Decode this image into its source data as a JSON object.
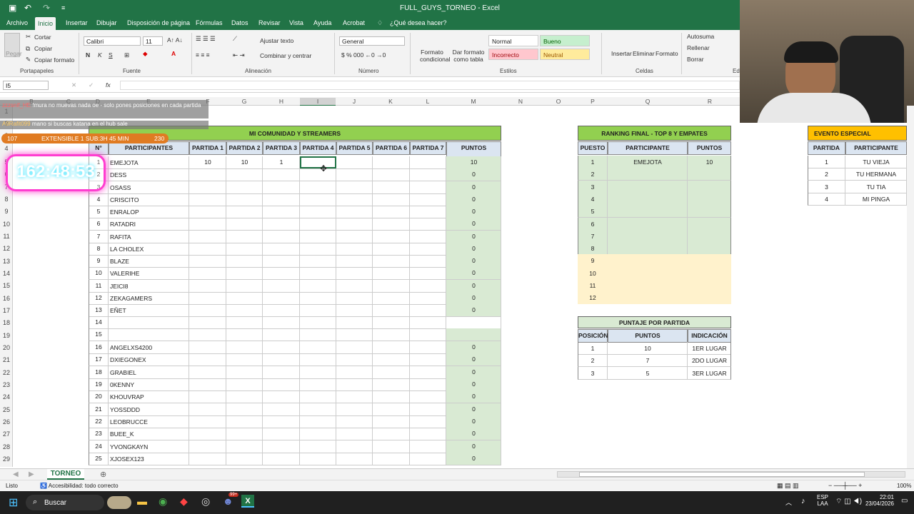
{
  "title": {
    "file": "FULL_GUYS_TORNEO",
    "app": "Excel",
    "sep": " - "
  },
  "tabs": [
    "Archivo",
    "Inicio",
    "Insertar",
    "Dibujar",
    "Disposición de página",
    "Fórmulas",
    "Datos",
    "Revisar",
    "Vista",
    "Ayuda",
    "Acrobat"
  ],
  "tell": "¿Qué desea hacer?",
  "ribbon": {
    "clipboard": {
      "paste": "Pegar",
      "cut": "Cortar",
      "copy": "Copiar",
      "format": "Copiar formato",
      "label": "Portapapeles"
    },
    "font": {
      "name": "Calibri",
      "size": "11",
      "label": "Fuente",
      "b": "N",
      "i": "K",
      "u": "S"
    },
    "align": {
      "wrap": "Ajustar texto",
      "merge": "Combinar y centrar",
      "label": "Alineación"
    },
    "number": {
      "format": "General",
      "label": "Número"
    },
    "styles": {
      "cond": "Formato condicional",
      "table": "Dar formato como tabla",
      "normal": "Normal",
      "good": "Bueno",
      "bad": "Incorrecto",
      "neutral": "Neutral",
      "label": "Estilos"
    },
    "cells": {
      "insert": "Insertar",
      "delete": "Eliminar",
      "format": "Formato",
      "label": "Celdas"
    },
    "edit": {
      "autosum": "Autosuma",
      "fill": "Rellenar",
      "clear": "Borrar",
      "label": "Ed"
    }
  },
  "namebox": "I5",
  "fx": "fx",
  "columns": [
    "B",
    "C",
    "D",
    "E",
    "F",
    "G",
    "H",
    "I",
    "J",
    "K",
    "L",
    "M",
    "N",
    "O",
    "P",
    "Q",
    "R"
  ],
  "main": {
    "title": "MI COMUNIDAD Y STREAMERS",
    "headers": [
      "N°",
      "PARTICIPANTES",
      "PARTIDA 1",
      "PARTIDA 2",
      "PARTIDA 3",
      "PARTIDA 4",
      "PARTIDA 5",
      "PARTIDA 6",
      "PARTIDA 7",
      "PUNTOS TOTALES"
    ],
    "rows": [
      {
        "n": "1",
        "name": "EMEJOTA",
        "p1": "10",
        "p2": "10",
        "p3": "1",
        "total": "10"
      },
      {
        "n": "2",
        "name": "DESS",
        "total": "0"
      },
      {
        "n": "3",
        "name": "OSASS",
        "total": "0"
      },
      {
        "n": "4",
        "name": "CRISCITO",
        "total": "0"
      },
      {
        "n": "5",
        "name": "ENRALOP",
        "total": "0"
      },
      {
        "n": "6",
        "name": "RATADRI",
        "total": "0"
      },
      {
        "n": "7",
        "name": "RAFITA",
        "total": "0"
      },
      {
        "n": "8",
        "name": "LA CHOLEX",
        "total": "0"
      },
      {
        "n": "9",
        "name": "BLAZE",
        "total": "0"
      },
      {
        "n": "10",
        "name": "VALERIHE",
        "total": "0"
      },
      {
        "n": "11",
        "name": "JEICI8",
        "total": "0"
      },
      {
        "n": "12",
        "name": "ZEKAGAMERS",
        "total": "0"
      },
      {
        "n": "13",
        "name": "EÑET",
        "total": "0"
      },
      {
        "n": "14",
        "name": ""
      },
      {
        "n": "15",
        "name": ""
      },
      {
        "n": "16",
        "name": "ANGELXS4200",
        "total": "0"
      },
      {
        "n": "17",
        "name": "DXIEGONEX",
        "total": "0"
      },
      {
        "n": "18",
        "name": "GRABIEL",
        "total": "0"
      },
      {
        "n": "19",
        "name": "0KENNY",
        "total": "0"
      },
      {
        "n": "20",
        "name": "KHOUVRAP",
        "total": "0"
      },
      {
        "n": "21",
        "name": "YOSSDDD",
        "total": "0"
      },
      {
        "n": "22",
        "name": "LEOBRUCCE",
        "total": "0"
      },
      {
        "n": "23",
        "name": "BUEE_K",
        "total": "0"
      },
      {
        "n": "24",
        "name": "YVONGKAYN",
        "total": "0"
      },
      {
        "n": "25",
        "name": "XJOSEX123",
        "total": "0"
      }
    ]
  },
  "ranking": {
    "title": "RANKING FINAL - TOP 8 Y EMPATES",
    "headers": [
      "PUESTO",
      "PARTICIPANTE",
      "PUNTOS"
    ],
    "rows": [
      {
        "p": "1",
        "name": "EMEJOTA",
        "pts": "10"
      },
      {
        "p": "2"
      },
      {
        "p": "3"
      },
      {
        "p": "4"
      },
      {
        "p": "5"
      },
      {
        "p": "6"
      },
      {
        "p": "7"
      },
      {
        "p": "8"
      },
      {
        "p": "9"
      },
      {
        "p": "10"
      },
      {
        "p": "11"
      },
      {
        "p": "12"
      }
    ]
  },
  "puntaje": {
    "title": "PUNTAJE POR PARTIDA",
    "headers": [
      "POSICIÓN",
      "PUNTOS",
      "INDICACIÓN"
    ],
    "rows": [
      {
        "pos": "1",
        "pts": "10",
        "ind": "1ER LUGAR"
      },
      {
        "pos": "2",
        "pts": "7",
        "ind": "2DO LUGAR"
      },
      {
        "pos": "3",
        "pts": "5",
        "ind": "3ER LUGAR"
      }
    ]
  },
  "evento": {
    "title": "EVENTO ESPECIAL COMUNIDAD",
    "headers": [
      "PARTIDA",
      "PARTICIPANTE"
    ],
    "rows": [
      {
        "p": "1",
        "name": "TU VIEJA"
      },
      {
        "p": "2",
        "name": "TU HERMANA"
      },
      {
        "p": "3",
        "name": "TU TIA"
      },
      {
        "p": "4",
        "name": "MI PINGA"
      }
    ]
  },
  "overlay": {
    "chat1_user": "zzzsnif_HE",
    "chat1": "!mura no muevas nada oe - solo pones posiciones en cada partida",
    "chat2_user": "A9Rafit099",
    "chat2": "mano si buscas katana en el hub sale",
    "bar_left": "107",
    "bar_mid": "EXTENSIBLE 1 SUB:3H 45 MIN",
    "bar_right": "230",
    "timer": "162:48:53"
  },
  "sheet": "TORNEO",
  "status": {
    "ready": "Listo",
    "access": "Accesibilidad: todo correcto",
    "zoom": "100%"
  },
  "taskbar": {
    "search": "Buscar",
    "lang": "ESP",
    "lang2": "LAA",
    "time": "22:01",
    "date": "23/04/2026",
    "badge": "99+"
  },
  "colors": {
    "excel": "#217346",
    "green_hdr": "#92d050",
    "light_green": "#d9ead3",
    "cream": "#fff2cc",
    "orange": "#ffc000",
    "blue_hdr": "#dbe5f1"
  }
}
